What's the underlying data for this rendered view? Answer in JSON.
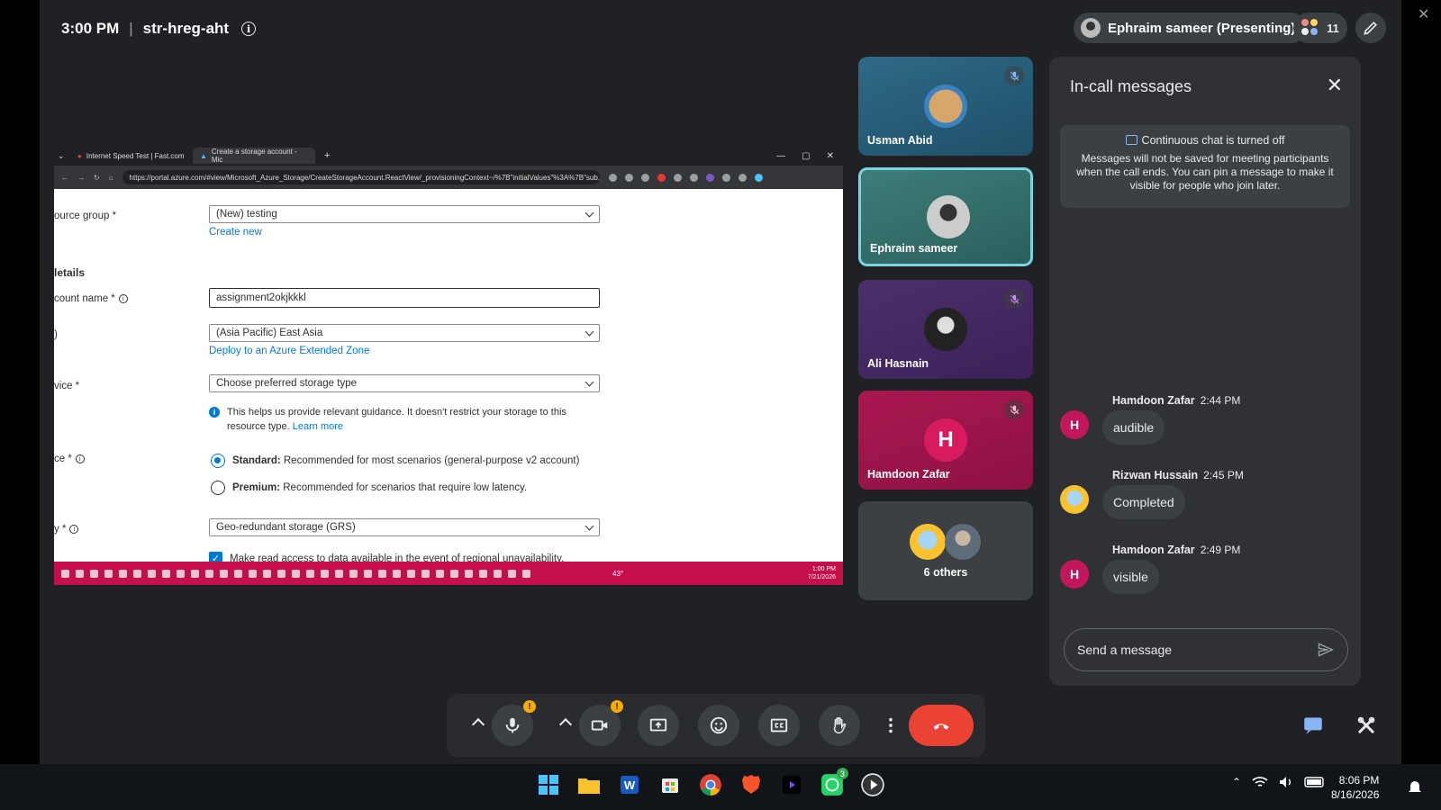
{
  "meeting": {
    "time": "3:00 PM",
    "separator": "|",
    "code": "str-hreg-aht"
  },
  "presenter_chip": "Ephraim sameer (Presenting)",
  "people_count": "11",
  "shared_screen": {
    "tabs": [
      "Internet Speed Test | Fast.com",
      "Create a storage account - Mic"
    ],
    "url": "https://portal.azure.com/#view/Microsoft_Azure_Storage/CreateStorageAccount.ReactView/_provisioningContext~/%7B\"initialValues\"%3A%7B\"sub...",
    "form": {
      "resource_group_label": "ource group *",
      "resource_group_value": "(New) testing",
      "create_new": "Create new",
      "section": "letails",
      "account_name_label": "count name *",
      "account_name_value": "assignment2okjkkkl",
      "region_label": ")",
      "region_value": "(Asia Pacific) East Asia",
      "extended_zone": "Deploy to an Azure Extended Zone",
      "service_label": "vice *",
      "service_value": "Choose preferred storage type",
      "note_text": "This helps us provide relevant guidance. It doesn't restrict your storage to this resource type.",
      "learn_more": "Learn more",
      "performance_label": "ce *",
      "standard_bold": "Standard:",
      "standard_text": "Recommended for most scenarios (general-purpose v2 account)",
      "premium_bold": "Premium:",
      "premium_text": "Recommended for scenarios that require low latency.",
      "redundancy_label": "y *",
      "redundancy_value": "Geo-redundant storage (GRS)",
      "read_access": "Make read access to data available in the event of regional unavailability."
    },
    "taskbar_clock": {
      "time": "1:00 PM",
      "date": "7/21/2026"
    },
    "weather": "43°"
  },
  "participants": [
    {
      "name": "Usman Abid",
      "muted": true
    },
    {
      "name": "Ephraim sameer",
      "muted": false
    },
    {
      "name": "Ali Hasnain",
      "muted": true
    },
    {
      "name": "Hamdoon Zafar",
      "muted": true,
      "initial": "H"
    }
  ],
  "others_label": "6 others",
  "chat": {
    "title": "In-call messages",
    "notice_title": "Continuous chat is turned off",
    "notice_body": "Messages will not be saved for meeting participants when the call ends. You can pin a message to make it visible for people who join later.",
    "messages": [
      {
        "sender": "Hamdoon Zafar",
        "time": "2:44 PM",
        "text": "audible",
        "initial": "H"
      },
      {
        "sender": "Rizwan Hussain",
        "time": "2:45 PM",
        "text": "Completed",
        "initial": ""
      },
      {
        "sender": "Hamdoon Zafar",
        "time": "2:49 PM",
        "text": "visible",
        "initial": "H"
      }
    ],
    "input_placeholder": "Send a message"
  },
  "controls": {
    "warn_mark": "!"
  },
  "whatsapp_badge": "3",
  "taskbar_clock": {
    "time": "8:06 PM",
    "date": "8/16/2026"
  },
  "colors": {
    "meet_bg": "#202124",
    "end_call": "#ea4335",
    "azure_blue": "#0078d4",
    "highlight_tile": "#7cd4e0"
  }
}
